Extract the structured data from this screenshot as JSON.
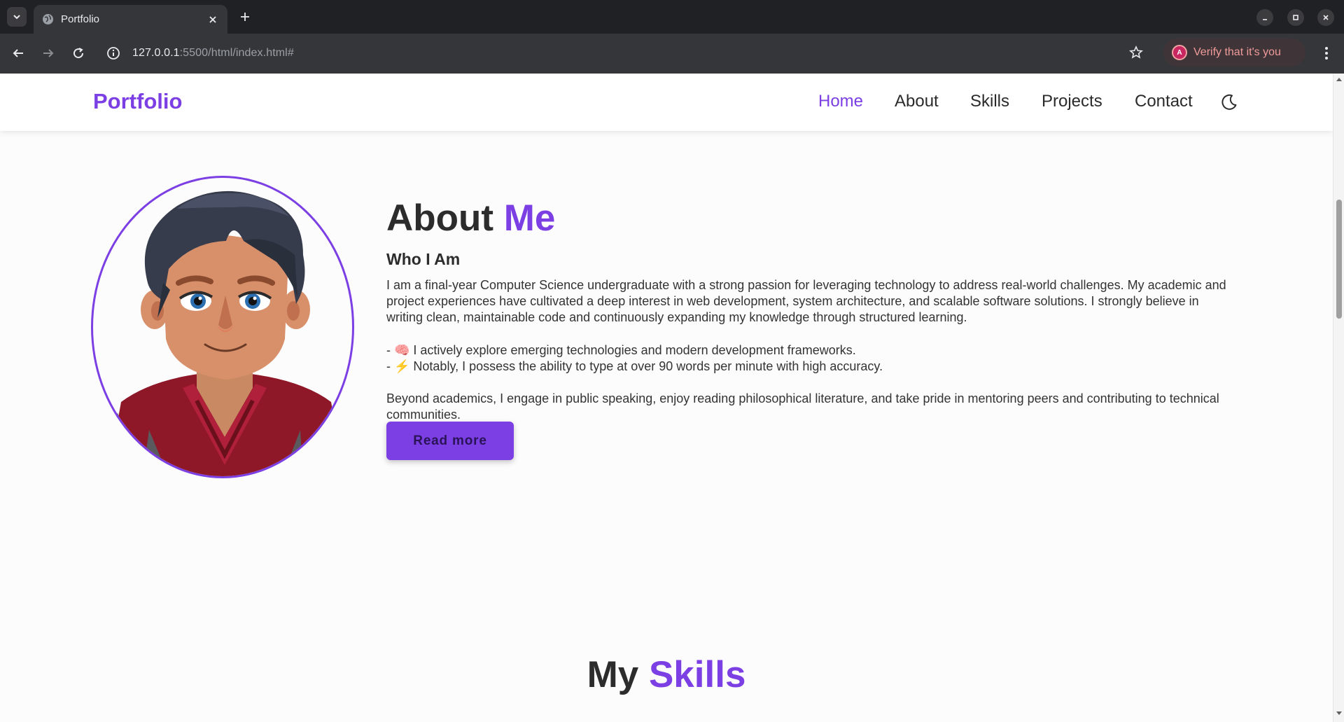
{
  "browser": {
    "tab_title": "Portfolio",
    "url_host": "127.0.0.1",
    "url_rest": ":5500/html/index.html#",
    "profile_initial": "A",
    "verify_label": "Verify that it's you"
  },
  "site": {
    "brand": "Portfolio",
    "nav": {
      "home": "Home",
      "about": "About",
      "skills": "Skills",
      "projects": "Projects",
      "contact": "Contact"
    },
    "theme_icon": "moon-icon"
  },
  "about": {
    "heading_main": "About ",
    "heading_accent": "Me",
    "subheading": "Who I Am",
    "paragraph1": "I am a final-year Computer Science undergraduate with a strong passion for leveraging technology to address real-world challenges. My academic and project experiences have cultivated a deep interest in web development, system architecture, and scalable software solutions. I strongly believe in writing clean, maintainable code and continuously expanding my knowledge through structured learning.",
    "bullet1": "- 🧠 I actively explore emerging technologies and modern development frameworks.",
    "bullet2": "- ⚡ Notably, I possess the ability to type at over 90 words per minute with high accuracy.",
    "paragraph2": "Beyond academics, I engage in public speaking, enjoy reading philosophical literature, and take pride in mentoring peers and contributing to technical communities.",
    "read_more": "Read more"
  },
  "skills": {
    "heading_main": "My ",
    "heading_accent": "Skills"
  },
  "colors": {
    "accent": "#7b3fe4",
    "text": "#2c2c2c",
    "chrome_dark": "#202124",
    "chrome_toolbar": "#35363a"
  }
}
